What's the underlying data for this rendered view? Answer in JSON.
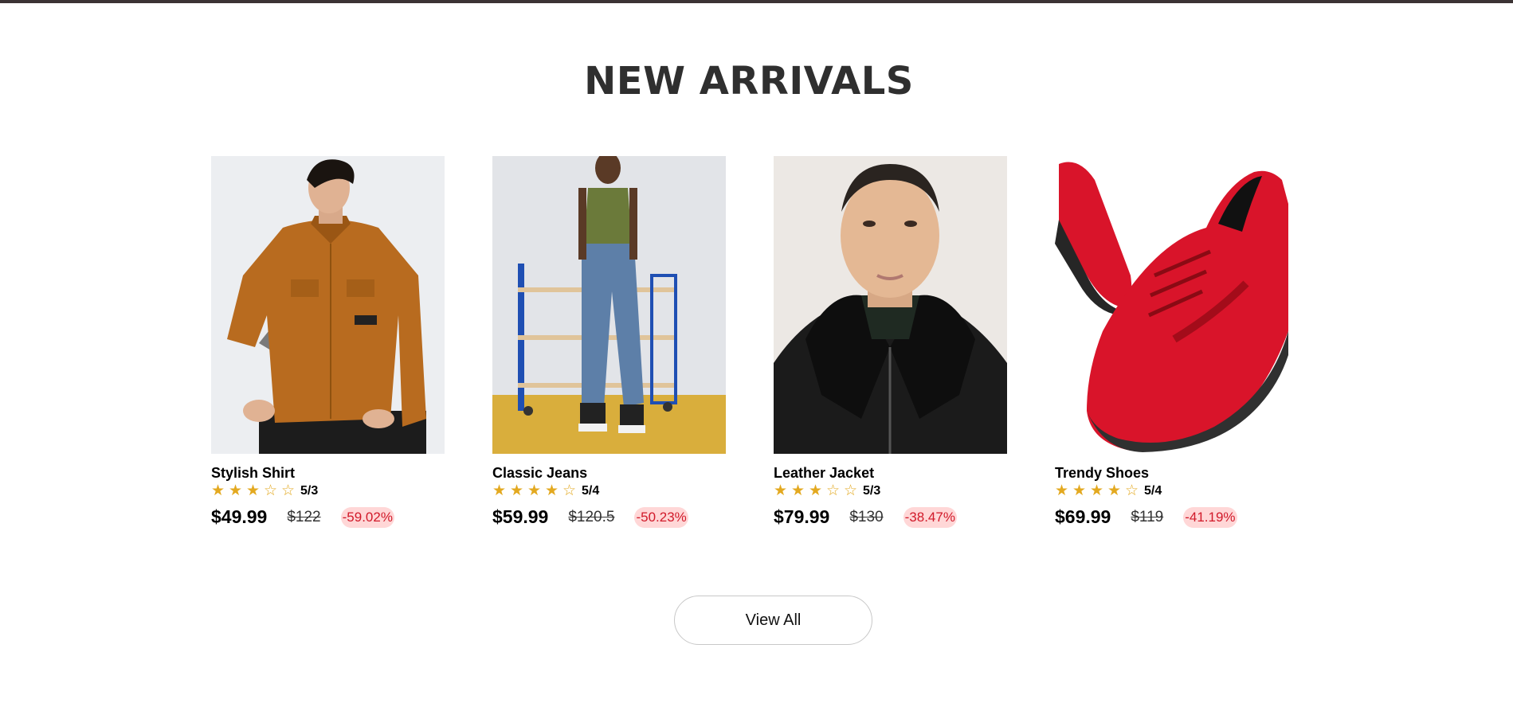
{
  "section": {
    "title": "NEW ARRIVALS"
  },
  "products": [
    {
      "name": "Stylish Shirt",
      "rating": 3,
      "max_rating": 5,
      "score": "5/3",
      "price": "$49.99",
      "old_price": "$122",
      "discount": "-59.02%"
    },
    {
      "name": "Classic Jeans",
      "rating": 4,
      "max_rating": 5,
      "score": "5/4",
      "price": "$59.99",
      "old_price": "$120.5",
      "discount": "-50.23%"
    },
    {
      "name": "Leather Jacket",
      "rating": 3,
      "max_rating": 5,
      "score": "5/3",
      "price": "$79.99",
      "old_price": "$130",
      "discount": "-38.47%"
    },
    {
      "name": "Trendy Shoes",
      "rating": 4,
      "max_rating": 5,
      "score": "5/4",
      "price": "$69.99",
      "old_price": "$119",
      "discount": "-41.19%"
    }
  ],
  "view_all": {
    "label": "View All"
  },
  "colors": {
    "star": "#e3a920",
    "discount_text": "#d11a2a",
    "discount_bg": "#ffd7d7",
    "title": "#2f2f2f",
    "top_bar": "#3b3334"
  }
}
